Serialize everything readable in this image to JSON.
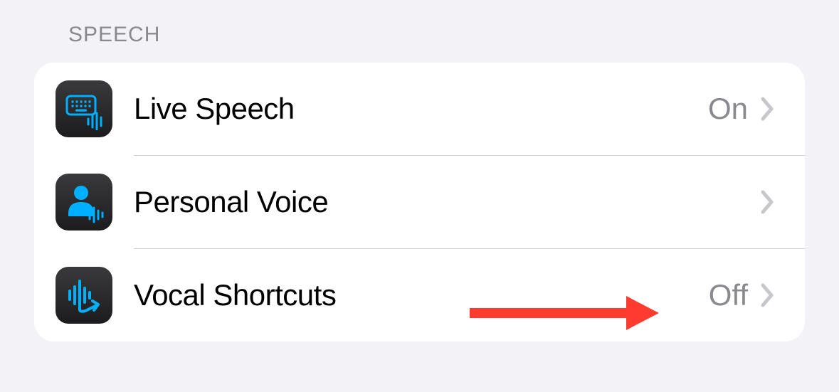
{
  "section": {
    "header": "SPEECH",
    "items": [
      {
        "label": "Live Speech",
        "value": "On",
        "icon": "keyboard-wave-icon"
      },
      {
        "label": "Personal Voice",
        "value": "",
        "icon": "person-wave-icon"
      },
      {
        "label": "Vocal Shortcuts",
        "value": "Off",
        "icon": "wave-arrow-icon"
      }
    ]
  },
  "colors": {
    "accent": "#0a84ff",
    "iconAccent": "#00b0ff",
    "annotation": "#ff3b30"
  }
}
